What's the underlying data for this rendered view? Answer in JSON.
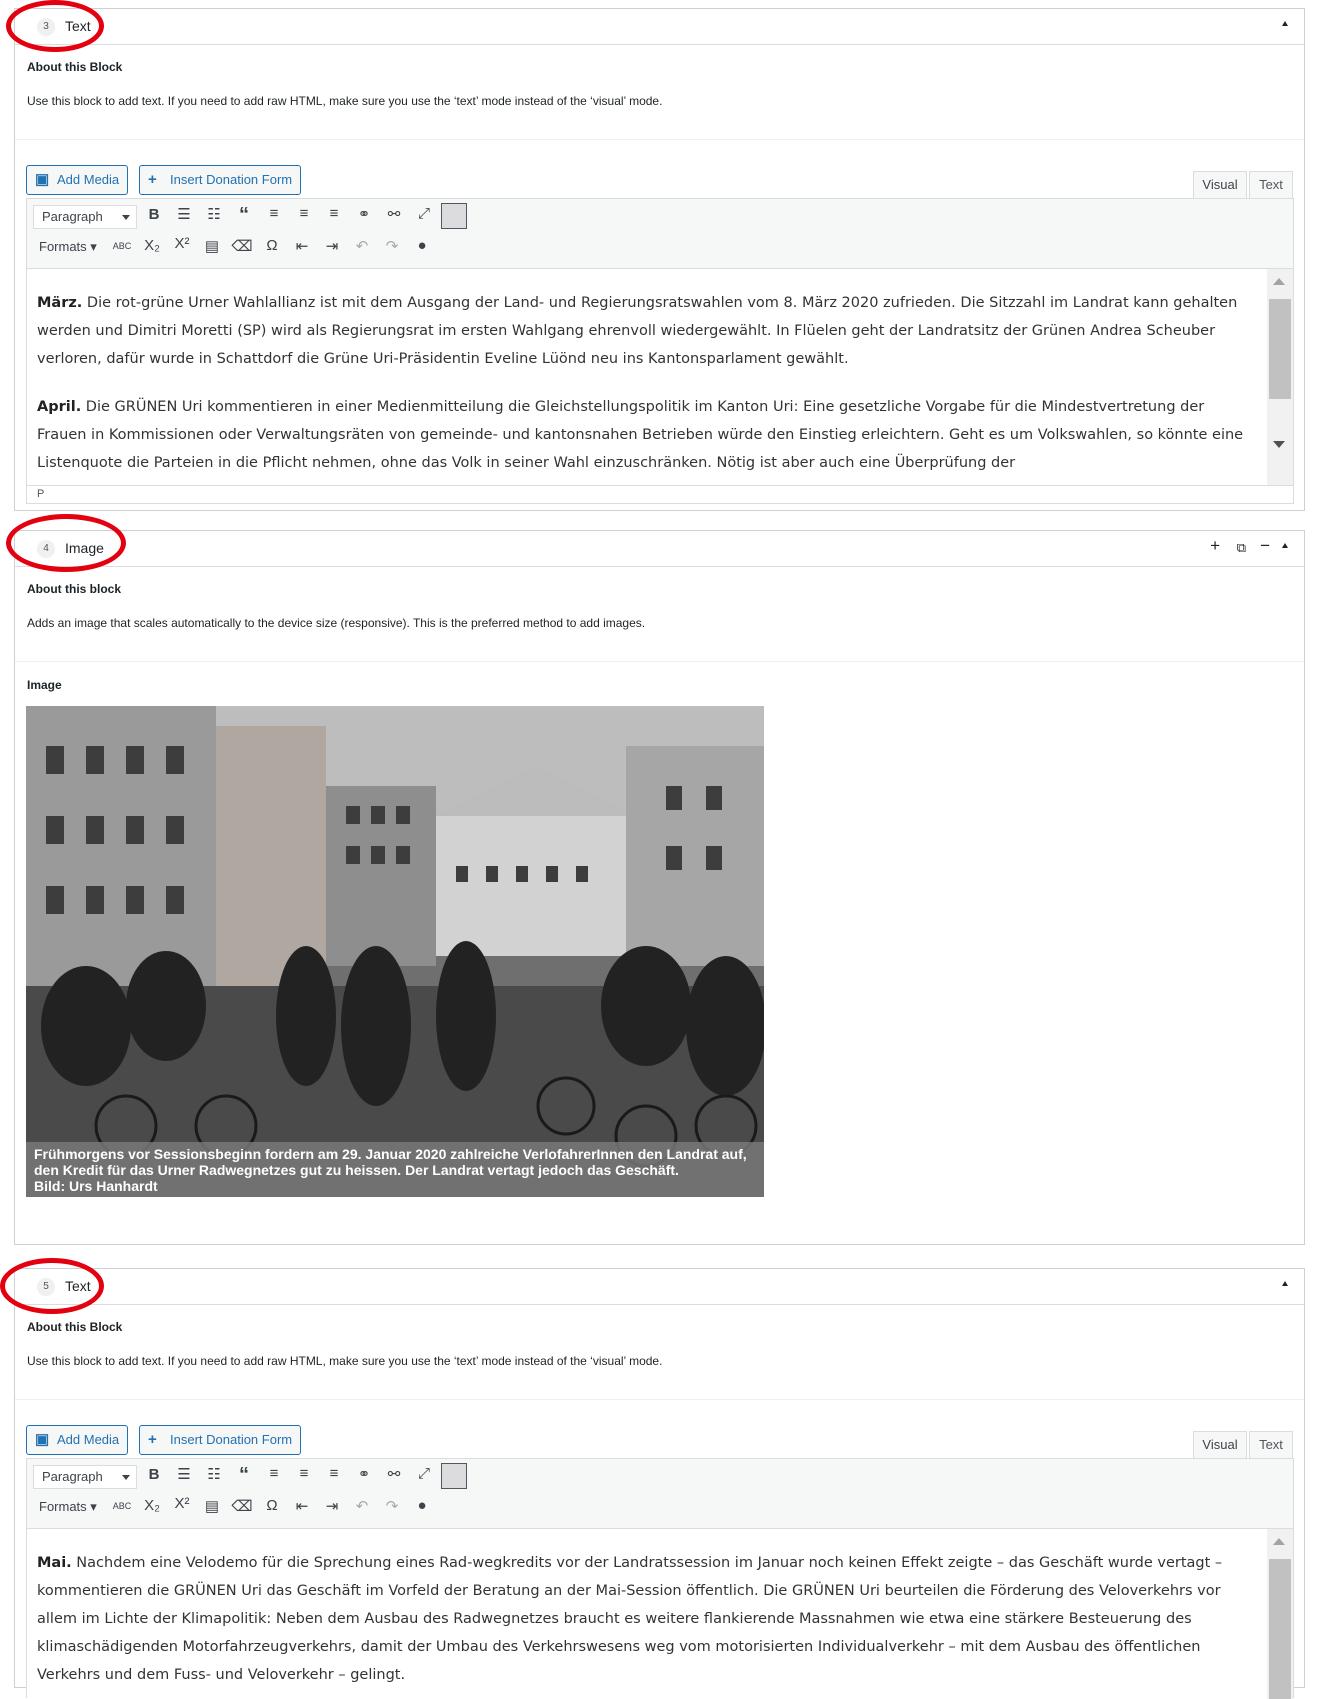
{
  "blocks": [
    {
      "number": "3",
      "title": "Text",
      "about_heading": "About this Block",
      "about_text": "Use this block to add text. If you need to add raw HTML, make sure you use the ‘text’ mode instead of the ‘visual’ mode.",
      "add_media": "Add Media",
      "insert_donation": "Insert Donation Form",
      "tab_visual": "Visual",
      "tab_text": "Text",
      "paragraph_select": "Paragraph",
      "formats": "Formats",
      "path": "P",
      "paragraphs": [
        {
          "lead": "März.",
          "text": " Die rot-grüne Urner Wahlallianz ist mit dem Ausgang der Land- und Regierungsratswahlen vom 8. März 2020 zufrieden. Die Sitzzahl im Landrat kann gehalten werden und Dimitri Moretti (SP) wird als Regierungsrat im ersten Wahlgang ehrenvoll wiedergewählt. In Flüelen geht der Landratsitz der Grünen Andrea Scheuber verloren, dafür wurde in Schattdorf die Grüne Uri-Präsidentin Eveline Lüönd neu ins Kantonsparlament gewählt."
        },
        {
          "lead": "April.",
          "text": " Die GRÜNEN Uri kommentieren in einer Medienmitteilung die Gleichstellungspolitik im Kanton Uri: Eine gesetzliche Vorgabe für die Mindestvertretung der Frauen in Kommissionen oder Verwaltungsräten von gemeinde- und kantonsnahen Betrieben würde den Einstieg erleichtern. Geht es um Volkswahlen, so könnte eine Listenquote die Parteien in die Pflicht nehmen, ohne das Volk in seiner Wahl einzuschränken. Nötig ist aber auch eine Überprüfung der"
        }
      ]
    },
    {
      "number": "4",
      "title": "Image",
      "about_heading": "About this block",
      "about_text": "Adds an image that scales automatically to the device size (responsive). This is the preferred method to add images.",
      "image_label": "Image",
      "caption_lines": [
        "Frühmorgens vor Sessionsbeginn fordern am 29. Januar 2020 zahlreiche VerlofahrerInnen den Landrat auf,",
        "den Kredit für das Urner Radwegnetzes gut zu heissen. Der Landrat vertagt jedoch das Geschäft.",
        "Bild: Urs Hanhardt"
      ]
    },
    {
      "number": "5",
      "title": "Text",
      "about_heading": "About this Block",
      "about_text": "Use this block to add text. If you need to add raw HTML, make sure you use the ‘text’ mode instead of the ‘visual’ mode.",
      "add_media": "Add Media",
      "insert_donation": "Insert Donation Form",
      "tab_visual": "Visual",
      "tab_text": "Text",
      "paragraph_select": "Paragraph",
      "formats": "Formats",
      "paragraphs": [
        {
          "lead": "Mai.",
          "text": " Nachdem eine Velodemo für die Sprechung eines Rad-wegkredits vor der Landratssession im Januar noch keinen Effekt zeigte – das Geschäft wurde vertagt – kommentieren die GRÜNEN Uri das Geschäft im Vorfeld der Beratung an der Mai-Session öffentlich. Die GRÜNEN Uri beurteilen die Förderung des Veloverkehrs vor allem im Lichte der Klimapolitik: Neben dem Ausbau des Radwegnetzes braucht es weitere flankierende Massnahmen wie etwa eine stärkere Besteuerung des klimaschädigenden Motorfahrzeugverkehrs, damit der Umbau des Verkehrswesens weg vom motorisierten Individualverkehr – mit dem Ausbau des öffentlichen Verkehrs und dem Fuss- und Veloverkehr – gelingt."
        }
      ]
    }
  ],
  "icons": {
    "add_media": "media-icon",
    "insert_donation": "plus-icon",
    "collapse": "arrow-up-icon"
  },
  "colors": {
    "annotation_circle": "#e3000f",
    "button_blue": "#2271b1"
  }
}
